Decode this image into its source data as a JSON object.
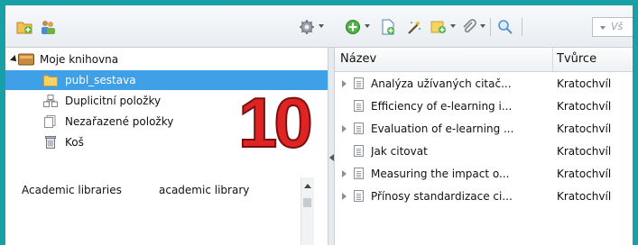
{
  "search": {
    "placeholder": "Vš"
  },
  "library": {
    "root_label": "Moje knihovna",
    "items": [
      {
        "label": "publ_sestava",
        "icon": "folder-icon",
        "selected": true
      },
      {
        "label": "Duplicitní položky",
        "icon": "duplicate-items-icon"
      },
      {
        "label": "Nezařazené položky",
        "icon": "unfiled-items-icon"
      },
      {
        "label": "Koš",
        "icon": "trash-icon"
      }
    ]
  },
  "tags": [
    "Academic libraries",
    "academic library"
  ],
  "columns": {
    "title": "Název",
    "creator": "Tvůrce"
  },
  "items": [
    {
      "title": "Analýza užívaných citač...",
      "creator": "Kratochvíl",
      "expandable": true
    },
    {
      "title": "Efficiency of e-learning i...",
      "creator": "Kratochvíl",
      "expandable": false
    },
    {
      "title": "Evaluation of e-learning ...",
      "creator": "Kratochvíl",
      "expandable": true
    },
    {
      "title": "Jak citovat",
      "creator": "Kratochvíl",
      "expandable": false
    },
    {
      "title": "Measuring the impact o...",
      "creator": "Kratochvíl",
      "expandable": true
    },
    {
      "title": "Přínosy standardizace ci...",
      "creator": "Kratochvíl",
      "expandable": true
    }
  ],
  "overlay": {
    "number": "10"
  },
  "colors": {
    "frame": "#18a0a6",
    "selection": "#3fa0e8",
    "overlay_number": "#e02424"
  }
}
